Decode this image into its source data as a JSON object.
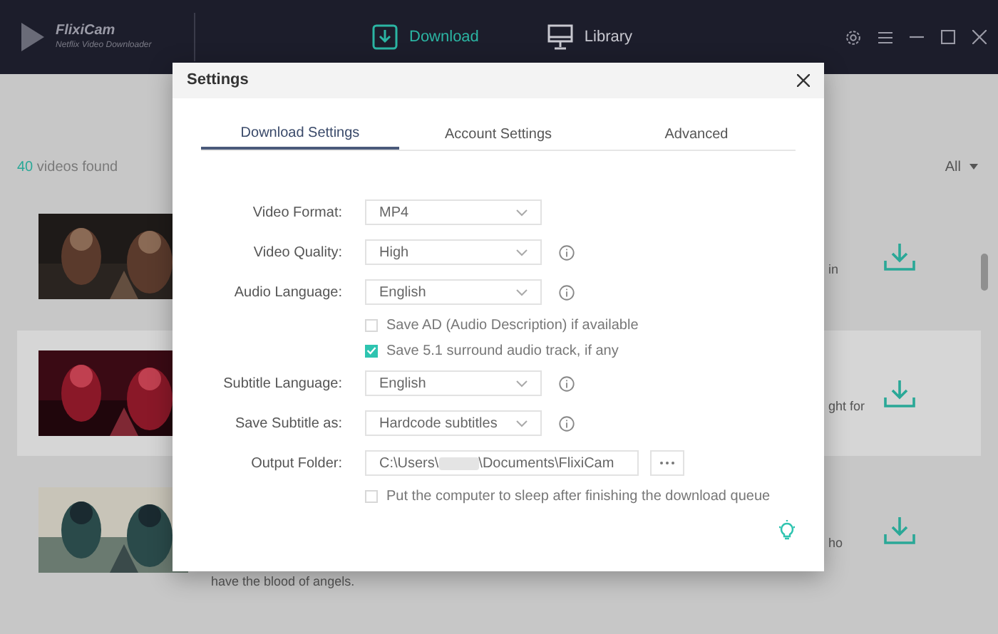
{
  "app": {
    "name": "FlixiCam",
    "subtitle": "Netflix Video Downloader"
  },
  "nav": [
    {
      "label": "Download",
      "selected": true
    },
    {
      "label": "Library",
      "selected": false
    }
  ],
  "list": {
    "count": "40",
    "count_label": "videos found",
    "filter": "All",
    "rows": [
      {
        "highlighted": false,
        "trailing_text": "in"
      },
      {
        "highlighted": true,
        "trailing_text": "ght for"
      },
      {
        "highlighted": false,
        "trailing_text": "ho",
        "description": "have the blood of angels."
      }
    ]
  },
  "settings": {
    "title": "Settings",
    "tabs": [
      {
        "label": "Download Settings",
        "selected": true
      },
      {
        "label": "Account Settings",
        "selected": false
      },
      {
        "label": "Advanced",
        "selected": false
      }
    ],
    "fields": [
      {
        "kind": "select",
        "label": "Video Format:",
        "value": "MP4",
        "info": false
      },
      {
        "kind": "select",
        "label": "Video Quality:",
        "value": "High",
        "info": true
      },
      {
        "kind": "select",
        "label": "Audio Language:",
        "value": "English",
        "info": true
      },
      {
        "kind": "checkbox",
        "label": "Save AD (Audio Description) if available",
        "checked": false
      },
      {
        "kind": "checkbox",
        "label": "Save 5.1 surround audio track, if any",
        "checked": true
      },
      {
        "kind": "select",
        "label": "Subtitle Language:",
        "value": "English",
        "info": true
      },
      {
        "kind": "select",
        "label": "Save Subtitle as:",
        "value": "Hardcode subtitles",
        "info": true
      },
      {
        "kind": "folder",
        "label": "Output Folder:",
        "value_start": "C:\\Users\\",
        "value_end": "\\Documents\\FlixiCam"
      },
      {
        "kind": "checkbox",
        "label": "Put the computer to sleep after finishing the download queue",
        "checked": false
      }
    ]
  }
}
